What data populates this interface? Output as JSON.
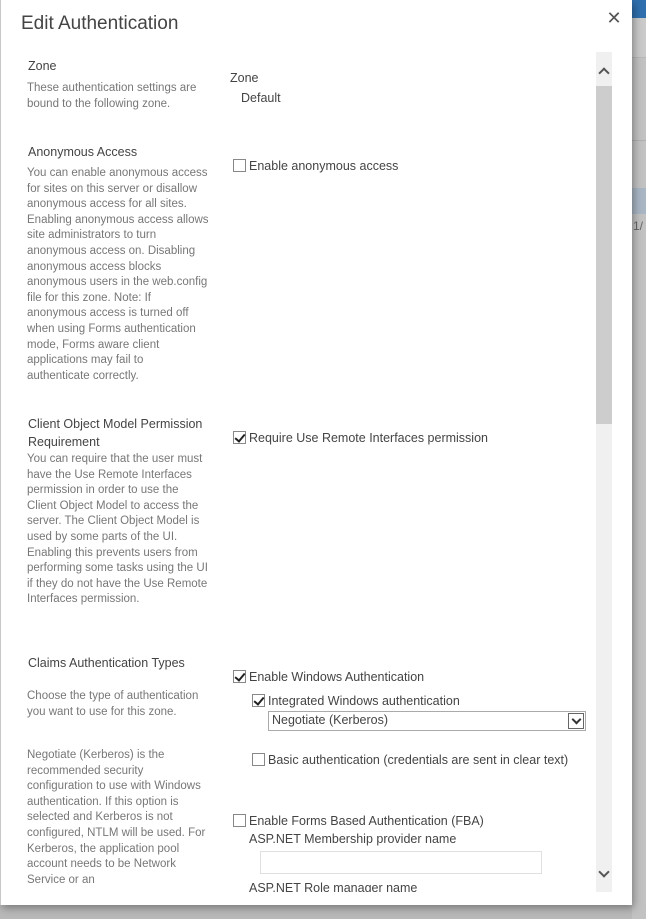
{
  "background": {
    "page_fragment": "1/"
  },
  "dialog": {
    "title": "Edit Authentication",
    "close_icon": "close-icon"
  },
  "sections": {
    "zone": {
      "title": "Zone",
      "description": "These authentication settings are bound to the following zone.",
      "field_label": "Zone",
      "field_value": "Default"
    },
    "anonymous": {
      "title": "Anonymous Access",
      "description": "You can enable anonymous access for sites on this server or disallow anonymous access for all sites. Enabling anonymous access allows site administrators to turn anonymous access on. Disabling anonymous access blocks anonymous users in the web.config file for this zone. Note: If anonymous access is turned off when using Forms authentication mode, Forms aware client applications may fail to authenticate correctly.",
      "checkbox_label": "Enable anonymous access",
      "checked": false
    },
    "client_object_model": {
      "title": "Client Object Model Permission Requirement",
      "description": "You can require that the user must have the Use Remote Interfaces permission in order to use the Client Object Model to access the server. The Client Object Model is used by some parts of the UI. Enabling this prevents users from performing some tasks using the UI if they do not have the Use Remote Interfaces permission.",
      "checkbox_label": "Require Use Remote Interfaces permission",
      "checked": true
    },
    "claims": {
      "title": "Claims Authentication Types",
      "description_1": "Choose the type of authentication you want to use for this zone.",
      "description_2": "Negotiate (Kerberos) is the recommended security configuration to use with Windows authentication. If this option is selected and Kerberos is not configured, NTLM will be used. For Kerberos, the application pool account needs to be Network Service or an",
      "windows_auth_label": "Enable Windows Authentication",
      "windows_auth_checked": true,
      "integrated_label": "Integrated Windows authentication",
      "integrated_checked": true,
      "integrated_select_value": "Negotiate (Kerberos)",
      "basic_label": "Basic authentication (credentials are sent in clear text)",
      "basic_checked": false,
      "fba_label": "Enable Forms Based Authentication (FBA)",
      "fba_checked": false,
      "membership_label": "ASP.NET Membership provider name",
      "membership_value": "",
      "role_manager_label": "ASP.NET Role manager name"
    }
  },
  "scrollbar": {
    "position_fraction": 0.0
  }
}
